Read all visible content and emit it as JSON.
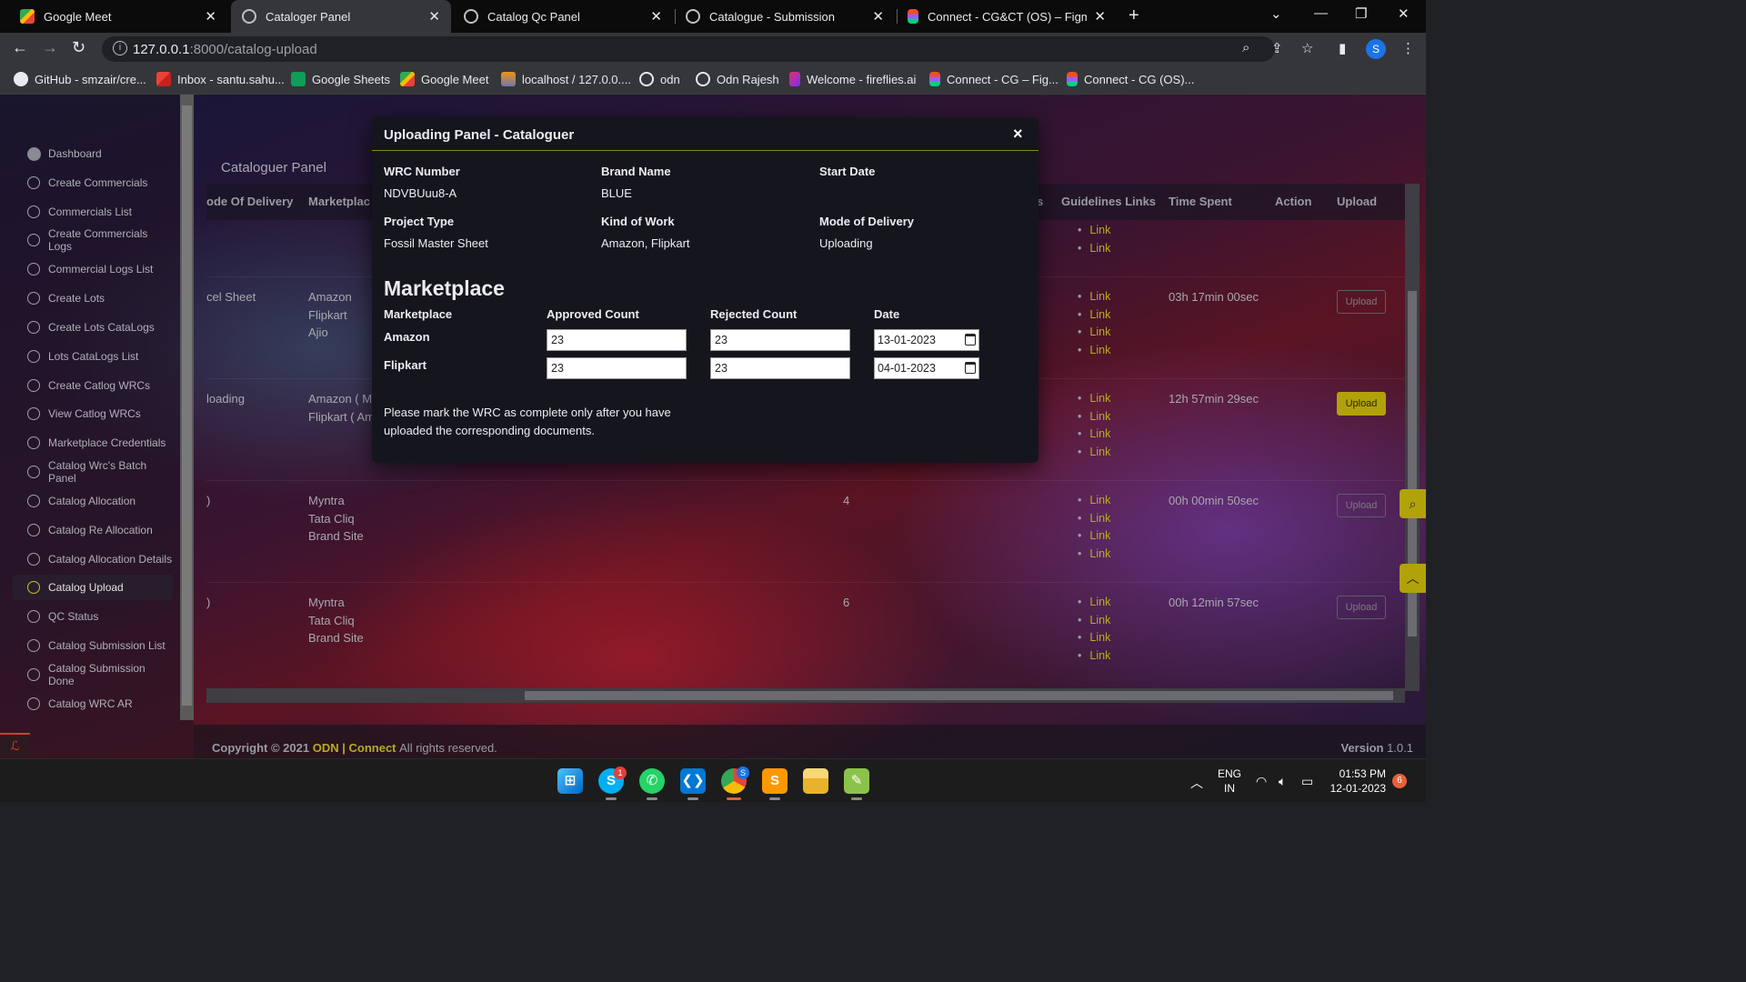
{
  "browser": {
    "tabs": [
      {
        "title": "Google Meet",
        "icon": "google-meet-icon"
      },
      {
        "title": "Cataloger Panel",
        "icon": "globe-icon"
      },
      {
        "title": "Catalog Qc Panel",
        "icon": "globe-icon"
      },
      {
        "title": "Catalogue - Submission",
        "icon": "globe-icon"
      },
      {
        "title": "Connect - CG&CT (OS) – Figma",
        "icon": "figma-icon"
      }
    ],
    "url_host": "127.0.0.1",
    "url_path": ":8000/catalog-upload",
    "profile_initial": "S",
    "bookmarks": [
      {
        "label": "GitHub - smzair/cre...",
        "icon": "github-icon"
      },
      {
        "label": "Inbox - santu.sahu...",
        "icon": "gmail-icon"
      },
      {
        "label": "Google Sheets",
        "icon": "sheets-icon"
      },
      {
        "label": "Google Meet",
        "icon": "meet-icon"
      },
      {
        "label": "localhost / 127.0.0....",
        "icon": "phpmyadmin-icon"
      },
      {
        "label": "odn",
        "icon": "globe-icon"
      },
      {
        "label": "Odn Rajesh",
        "icon": "globe-icon"
      },
      {
        "label": "Welcome - fireflies.ai",
        "icon": "fireflies-icon"
      },
      {
        "label": "Connect - CG – Fig...",
        "icon": "figma-icon"
      },
      {
        "label": "Connect - CG (OS)...",
        "icon": "figma-icon"
      }
    ]
  },
  "sidebar": {
    "items": [
      "Dashboard",
      "Create Commercials",
      "Commercials List",
      "Create Commercials Logs",
      "Commercial Logs List",
      "Create Lots",
      "Create Lots CataLogs",
      "Lots CataLogs List",
      "Create Catlog WRCs",
      "View Catlog WRCs",
      "Marketplace Credentials",
      "Catalog Wrc's Batch Panel",
      "Catalog Allocation",
      "Catalog Re Allocation",
      "Catalog Allocation Details",
      "Catalog Upload",
      "QC Status",
      "Catalog Submission List",
      "Catalog Submission Done",
      "Catalog WRC AR"
    ],
    "active": "Catalog Upload"
  },
  "panel": {
    "title": "Cataloguer Panel",
    "headers": {
      "mode": "ode Of Delivery",
      "marketplace": "Marketplac",
      "count_partial": "s",
      "guidelines": "Guidelines Links",
      "time_spent": "Time Spent",
      "action": "Action",
      "upload": "Upload"
    },
    "link_text": "Link",
    "upload_label": "Upload",
    "rows": [
      {
        "mode": "",
        "marketplace": "",
        "count": "",
        "links": 2,
        "time": "",
        "upload_enabled": null
      },
      {
        "mode": "cel Sheet",
        "marketplace": "Amazon\nFlipkart\nAjio",
        "count": "",
        "links": 4,
        "time": "03h 17min 00sec",
        "upload_enabled": false
      },
      {
        "mode": "loading",
        "marketplace": "Amazon ( M\nFlipkart ( Am",
        "count": "",
        "links": 4,
        "time": "12h 57min 29sec",
        "upload_enabled": true
      },
      {
        "mode": ")",
        "marketplace": "Myntra\nTata Cliq\nBrand Site",
        "count": "4",
        "links": 4,
        "time": "00h 00min 50sec",
        "upload_enabled": false
      },
      {
        "mode": ")",
        "marketplace": "Myntra\nTata Cliq\nBrand Site",
        "count": "6",
        "links": 4,
        "time": "00h 12min 57sec",
        "upload_enabled": false
      }
    ]
  },
  "footer": {
    "copyright": "Copyright © 2021",
    "brand1": "ODN",
    "separator": "|",
    "brand2": "Connect",
    "rights": "All rights reserved.",
    "version_label": "Version",
    "version": "1.0.1"
  },
  "modal": {
    "title": "Uploading Panel - Cataloguer",
    "close": "×",
    "info": {
      "wrc_label": "WRC Number",
      "wrc_value": "NDVBUuu8-A",
      "brand_label": "Brand Name",
      "brand_value": "BLUE",
      "start_label": "Start Date",
      "start_value": "",
      "project_label": "Project Type",
      "project_value": "Fossil Master Sheet",
      "kind_label": "Kind of Work",
      "kind_value": "Amazon, Flipkart",
      "delivery_label": "Mode of Delivery",
      "delivery_value": "Uploading"
    },
    "marketplace_heading": "Marketplace",
    "columns": {
      "marketplace": "Marketplace",
      "approved": "Approved Count",
      "rejected": "Rejected Count",
      "date": "Date"
    },
    "rows": [
      {
        "marketplace": "Amazon",
        "approved": "23",
        "rejected": "23",
        "date": "13-01-2023"
      },
      {
        "marketplace": "Flipkart",
        "approved": "23",
        "rejected": "23",
        "date": "04-01-2023"
      }
    ],
    "notice": "Please mark the WRC as complete only after you have uploaded the corresponding documents."
  },
  "taskbar": {
    "skype_badge": "1",
    "chrome_badge": "S",
    "lang_line1": "ENG",
    "lang_line2": "IN",
    "time": "01:53 PM",
    "date": "12-01-2023",
    "notifications": "6"
  },
  "colors": {
    "accent": "#b5ad22",
    "button_accent": "#b1a20a",
    "modal_bg": "#15161d"
  }
}
